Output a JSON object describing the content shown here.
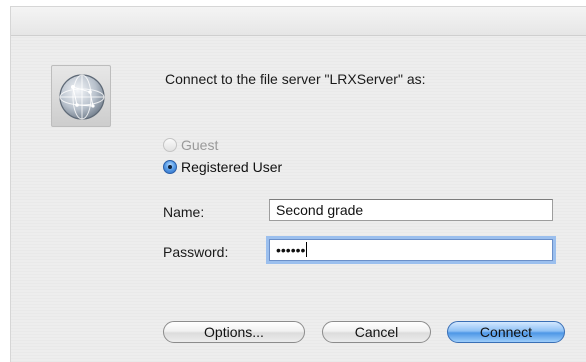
{
  "dialog": {
    "prompt": "Connect to the file server \"LRXServer\" as:",
    "icon": "network-server-globe-icon"
  },
  "login_type": {
    "guest_label": "Guest",
    "guest_enabled": false,
    "registered_label": "Registered User",
    "selected": "registered"
  },
  "fields": {
    "name_label": "Name:",
    "name_value": "Second grade",
    "password_label": "Password:",
    "password_mask": "••••••"
  },
  "buttons": {
    "options_label": "Options...",
    "cancel_label": "Cancel",
    "connect_label": "Connect"
  },
  "colors": {
    "default_button": "#4e97e6",
    "focus_ring": "#9bbfee"
  }
}
